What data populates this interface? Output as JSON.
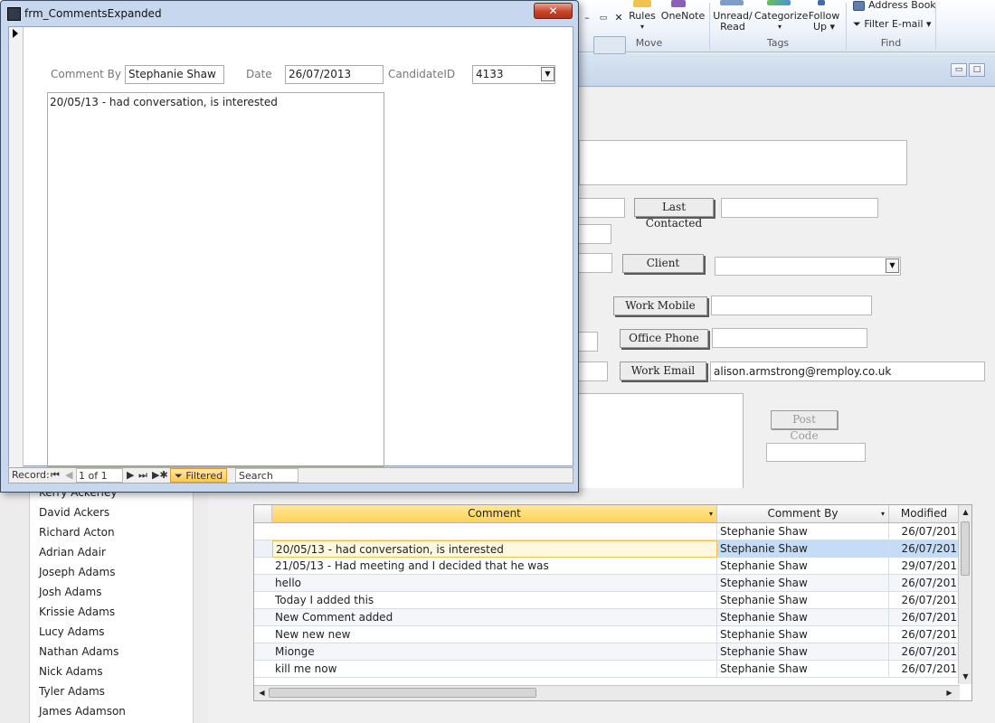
{
  "ribbon": {
    "rules": "Rules",
    "onenote": "OneNote",
    "move_group": "Move",
    "unread_read_1": "Unread/",
    "unread_read_2": "Read",
    "categorize": "Categorize",
    "follow_up_1": "Follow",
    "follow_up_2": "Up",
    "tags_group": "Tags",
    "address_book": "Address Book",
    "filter_email": "Filter E-mail",
    "find_group": "Find"
  },
  "popup": {
    "title": "frm_CommentsExpanded",
    "close_glyph": "✕",
    "comment_by_label": "Comment By",
    "comment_by_value": "Stephanie Shaw",
    "date_label": "Date",
    "date_value": "26/07/2013",
    "candidate_label": "CandidateID",
    "candidate_value": "4133",
    "comment_text": "20/05/13 - had conversation, is interested",
    "nav": {
      "record_label": "Record:",
      "record_pos": "1 of 1",
      "filtered": "Filtered",
      "search": "Search"
    }
  },
  "form": {
    "last_contacted": "Last Contacted",
    "client": "Client",
    "work_mobile": "Work Mobile",
    "office_phone": "Office Phone",
    "work_email": "Work Email",
    "work_email_value": "alison.armstrong@remploy.co.uk",
    "post_code": "Post Code"
  },
  "names": [
    "Kerry Ackerley",
    "David Ackers",
    "Richard Acton",
    "Adrian Adair",
    "Joseph Adams",
    "Josh Adams",
    "Krissie Adams",
    "Lucy Adams",
    "Nathan Adams",
    "Nick Adams",
    "Tyler Adams",
    "James Adamson"
  ],
  "grid": {
    "headers": [
      "Comment",
      "Comment By",
      "Modified"
    ],
    "rows": [
      [
        "",
        "Stephanie Shaw",
        "26/07/201"
      ],
      [
        "20/05/13 - had conversation, is interested",
        "Stephanie Shaw",
        "26/07/201"
      ],
      [
        "21/05/13 - Had meeting and I decided that he was",
        "Stephanie Shaw",
        "29/07/201"
      ],
      [
        "hello",
        "Stephanie Shaw",
        "26/07/201"
      ],
      [
        "Today I added this",
        "Stephanie Shaw",
        "26/07/201"
      ],
      [
        "New Comment added",
        "Stephanie Shaw",
        "26/07/201"
      ],
      [
        "New new new",
        "Stephanie Shaw",
        "26/07/201"
      ],
      [
        "Mionge",
        "Stephanie Shaw",
        "26/07/201"
      ],
      [
        "kill me now",
        "Stephanie Shaw",
        "26/07/201"
      ]
    ]
  },
  "colors": {
    "ribbon": "#eef3fa",
    "active_header": "#ffd256",
    "selection_blue": "#c5dcf6",
    "close_red": "#c7432b"
  }
}
